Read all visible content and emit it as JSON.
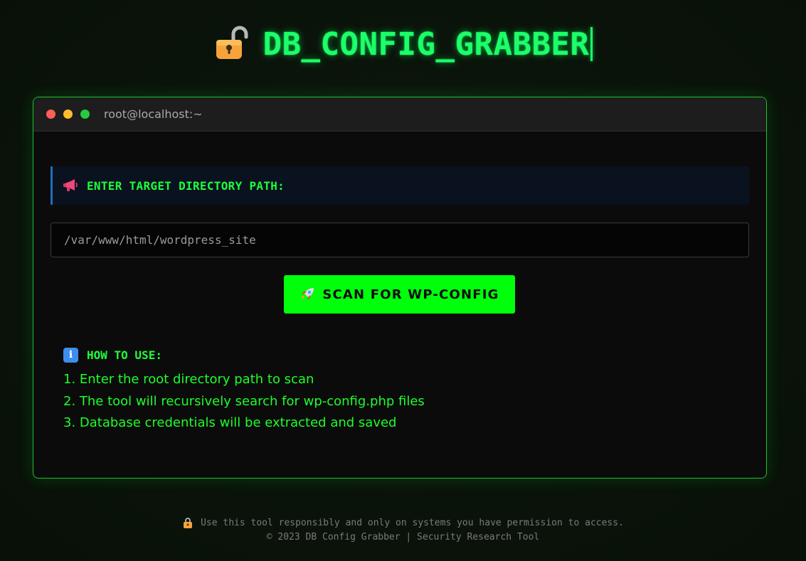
{
  "app": {
    "title": "DB_CONFIG_GRABBER",
    "title_icon": "unlocked-padlock-icon"
  },
  "terminal": {
    "window_title": "root@localhost:~",
    "controls": [
      "close",
      "minimize",
      "maximize"
    ]
  },
  "prompt": {
    "icon": "megaphone-icon",
    "label": "ENTER TARGET DIRECTORY PATH:"
  },
  "path_input": {
    "value": "",
    "placeholder": "/var/www/html/wordpress_site"
  },
  "scan_button": {
    "icon": "rocket-icon",
    "label": "SCAN FOR WP-CONFIG"
  },
  "howto": {
    "icon": "info-icon",
    "title": "HOW TO USE:",
    "steps": [
      "1. Enter the root directory path to scan",
      "2. The tool will recursively search for wp-config.php files",
      "3. Database credentials will be extracted and saved"
    ]
  },
  "footer": {
    "icon": "locked-padlock-icon",
    "notice": "Use this tool responsibly and only on systems you have permission to access.",
    "copyright": "© 2023 DB Config Grabber | Security Research Tool"
  },
  "colors": {
    "accent": "#00ff0a",
    "title": "#1dff6a",
    "terminal_border": "#1fbf2a",
    "prompt_border": "#1f6fb8"
  }
}
